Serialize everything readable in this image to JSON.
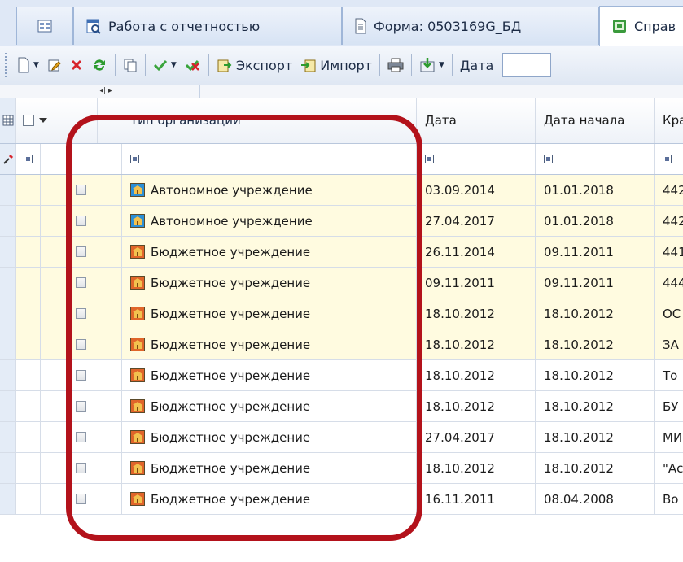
{
  "tabs": [
    {
      "label": ""
    },
    {
      "label": "Работа с отчетностью"
    },
    {
      "label": "Форма: 0503169G_БД"
    },
    {
      "label": "Справ"
    }
  ],
  "toolbar": {
    "export_label": "Экспорт",
    "import_label": "Импорт",
    "date_label": "Дата"
  },
  "grid": {
    "columns": [
      "Тип организации",
      "Дата",
      "Дата начала",
      "Кра"
    ],
    "rows": [
      {
        "type": "Автономное учреждение",
        "date": "03.09.2014",
        "start": "01.01.2018",
        "short": "442",
        "icon": "autonomous",
        "highlight": true
      },
      {
        "type": "Автономное учреждение",
        "date": "27.04.2017",
        "start": "01.01.2018",
        "short": "442",
        "icon": "autonomous",
        "highlight": true
      },
      {
        "type": "Бюджетное учреждение",
        "date": "26.11.2014",
        "start": "09.11.2011",
        "short": "441",
        "icon": "budget",
        "highlight": true
      },
      {
        "type": "Бюджетное учреждение",
        "date": "09.11.2011",
        "start": "09.11.2011",
        "short": "444",
        "icon": "budget",
        "highlight": true
      },
      {
        "type": "Бюджетное учреждение",
        "date": "18.10.2012",
        "start": "18.10.2012",
        "short": "ОС",
        "icon": "budget",
        "highlight": true
      },
      {
        "type": "Бюджетное учреждение",
        "date": "18.10.2012",
        "start": "18.10.2012",
        "short": "ЗА",
        "icon": "budget",
        "highlight": true
      },
      {
        "type": "Бюджетное учреждение",
        "date": "18.10.2012",
        "start": "18.10.2012",
        "short": "То",
        "icon": "budget",
        "highlight": false
      },
      {
        "type": "Бюджетное учреждение",
        "date": "18.10.2012",
        "start": "18.10.2012",
        "short": "БУ",
        "icon": "budget",
        "highlight": false
      },
      {
        "type": "Бюджетное учреждение",
        "date": "27.04.2017",
        "start": "18.10.2012",
        "short": "МИ",
        "icon": "budget",
        "highlight": false
      },
      {
        "type": "Бюджетное учреждение",
        "date": "18.10.2012",
        "start": "18.10.2012",
        "short": "\"Ас",
        "icon": "budget",
        "highlight": false
      },
      {
        "type": "Бюджетное учреждение",
        "date": "16.11.2011",
        "start": "08.04.2008",
        "short": "Во",
        "icon": "budget",
        "highlight": false
      }
    ]
  },
  "colors": {
    "highlight_row": "#fffbe0",
    "annotation": "#b3121b",
    "autonomous_icon": "#2b8fd6",
    "budget_icon": "#e0652a"
  }
}
